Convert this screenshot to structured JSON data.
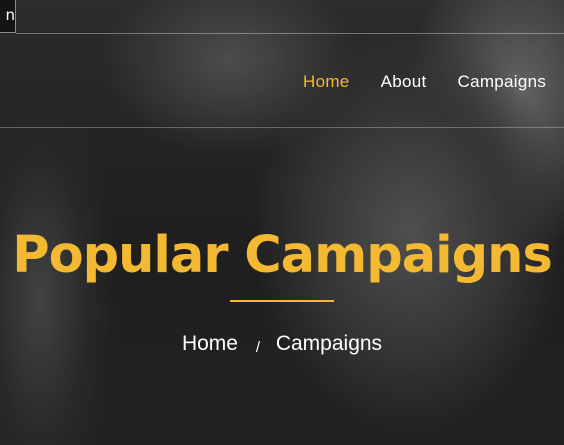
{
  "top_tab": {
    "text": "n"
  },
  "nav": {
    "items": [
      {
        "label": "Home",
        "active": true
      },
      {
        "label": "About",
        "active": false
      },
      {
        "label": "Campaigns",
        "active": false
      }
    ]
  },
  "hero": {
    "title": "Popular Campaigns",
    "breadcrumb": {
      "home": "Home",
      "separator": "/",
      "current": "Campaigns"
    }
  },
  "colors": {
    "accent": "#f4b933",
    "text": "#ffffff"
  }
}
